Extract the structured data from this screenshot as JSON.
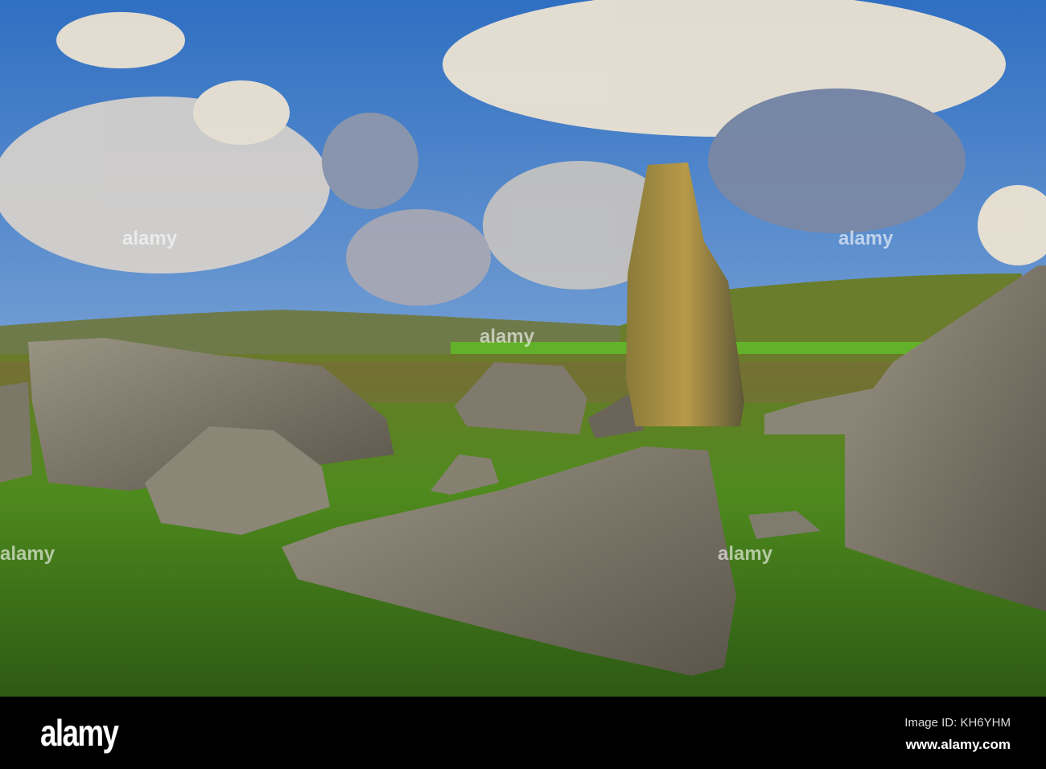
{
  "photo": {
    "subject": "standing stone and boulders on moorland"
  },
  "watermark": {
    "text": "alamy"
  },
  "footer": {
    "logo": "alamy",
    "image_id": "Image ID: KH6YHM",
    "website": "www.alamy.com"
  }
}
